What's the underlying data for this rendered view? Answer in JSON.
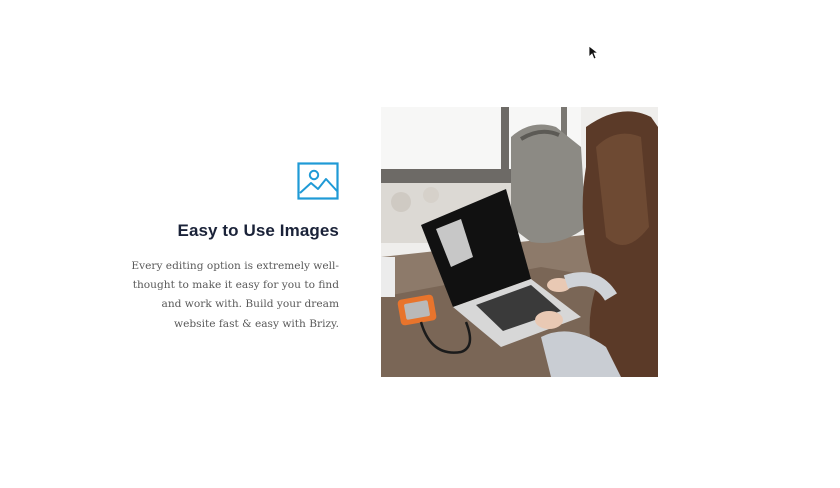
{
  "feature": {
    "icon": "image-icon",
    "title": "Easy to Use Images",
    "description": "Every editing option is extremely well-thought to make it easy for you to find and work with. Build your dream website fast & easy with Brizy."
  },
  "photo": {
    "subject": "woman-working-on-laptop"
  },
  "colors": {
    "accent": "#1f9ad6",
    "title": "#1a2238",
    "body_text": "#595959",
    "background": "#ffffff"
  }
}
